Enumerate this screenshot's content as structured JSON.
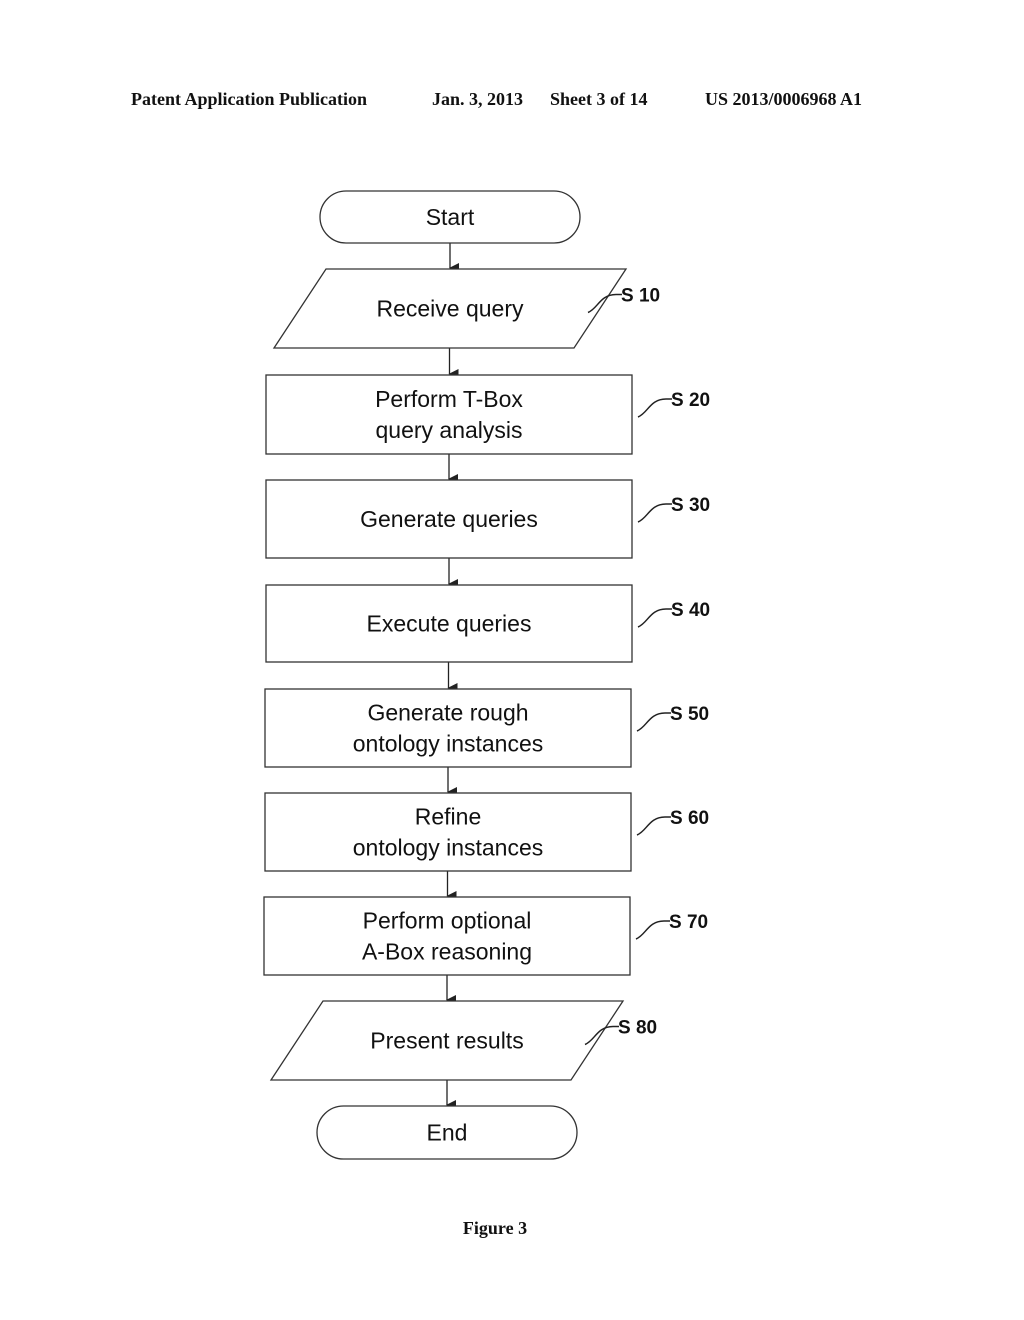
{
  "header": {
    "publication_type": "Patent Application Publication",
    "date": "Jan. 3, 2013",
    "sheet": "Sheet 3 of 14",
    "publication_number": "US 2013/0006968 A1"
  },
  "flowchart": {
    "nodes": [
      {
        "id": "start",
        "shape": "terminator",
        "lines": [
          "Start"
        ],
        "step": ""
      },
      {
        "id": "s10",
        "shape": "io",
        "lines": [
          "Receive query"
        ],
        "step": "S 10"
      },
      {
        "id": "s20",
        "shape": "process",
        "lines": [
          "Perform T-Box",
          "query analysis"
        ],
        "step": "S 20"
      },
      {
        "id": "s30",
        "shape": "process",
        "lines": [
          "Generate queries"
        ],
        "step": "S 30"
      },
      {
        "id": "s40",
        "shape": "process",
        "lines": [
          "Execute queries"
        ],
        "step": "S 40"
      },
      {
        "id": "s50",
        "shape": "process",
        "lines": [
          "Generate rough",
          "ontology instances"
        ],
        "step": "S 50"
      },
      {
        "id": "s60",
        "shape": "process",
        "lines": [
          "Refine",
          "ontology instances"
        ],
        "step": "S 60"
      },
      {
        "id": "s70",
        "shape": "process",
        "lines": [
          "Perform optional",
          "A-Box reasoning"
        ],
        "step": "S 70"
      },
      {
        "id": "s80",
        "shape": "io",
        "lines": [
          "Present results"
        ],
        "step": "S 80"
      },
      {
        "id": "end",
        "shape": "terminator",
        "lines": [
          "End"
        ],
        "step": ""
      }
    ],
    "edges": [
      [
        "start",
        "s10"
      ],
      [
        "s10",
        "s20"
      ],
      [
        "s20",
        "s30"
      ],
      [
        "s30",
        "s40"
      ],
      [
        "s40",
        "s50"
      ],
      [
        "s50",
        "s60"
      ],
      [
        "s60",
        "s70"
      ],
      [
        "s70",
        "s80"
      ],
      [
        "s80",
        "end"
      ]
    ],
    "colors": {
      "stroke": "#333333",
      "text": "#111111",
      "fill": "#ffffff"
    }
  },
  "caption": "Figure 3"
}
